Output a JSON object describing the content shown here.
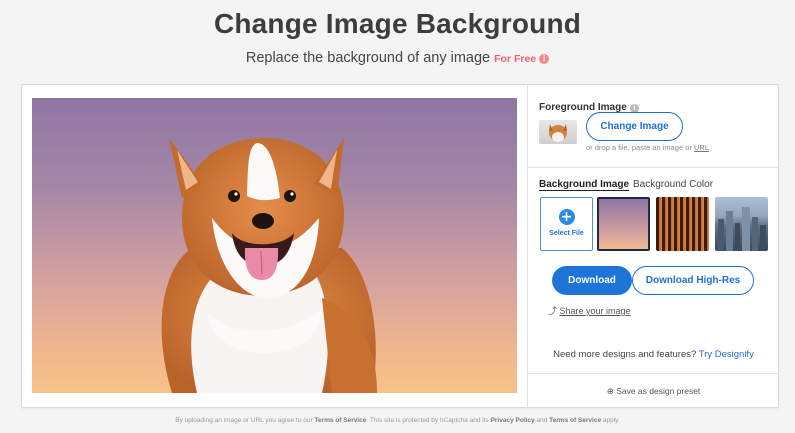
{
  "header": {
    "title": "Change Image Background",
    "subtitle": "Replace the background of any image",
    "for_free": "For Free",
    "info_icon": "info-icon"
  },
  "sidebar": {
    "foreground_label": "Foreground Image",
    "change_image_button": "Change Image",
    "drop_hint_prefix": "or drop a file, paste an image or",
    "drop_hint_link": "URL",
    "tabs": [
      {
        "label": "Background Image",
        "active": true
      },
      {
        "label": "Background Color",
        "active": false
      }
    ],
    "select_file_label": "Select File",
    "download_button": "Download",
    "download_highres_button": "Download High-Res",
    "share_label": "Share your image",
    "more_prefix": "Need more designs and features?",
    "more_link": "Try Designify",
    "save_preset": "Save as design preset"
  },
  "footer": {
    "p1": "By uploading an image or URL you agree to our",
    "tos": "Terms of Service",
    "p2": ". This site is protected by hCaptcha and its",
    "privacy": "Privacy Policy",
    "p3": "and",
    "tos2": "Terms of Service",
    "p4": "apply."
  },
  "colors": {
    "primary": "#1d75d8",
    "accent_red": "#ee5f6a"
  }
}
